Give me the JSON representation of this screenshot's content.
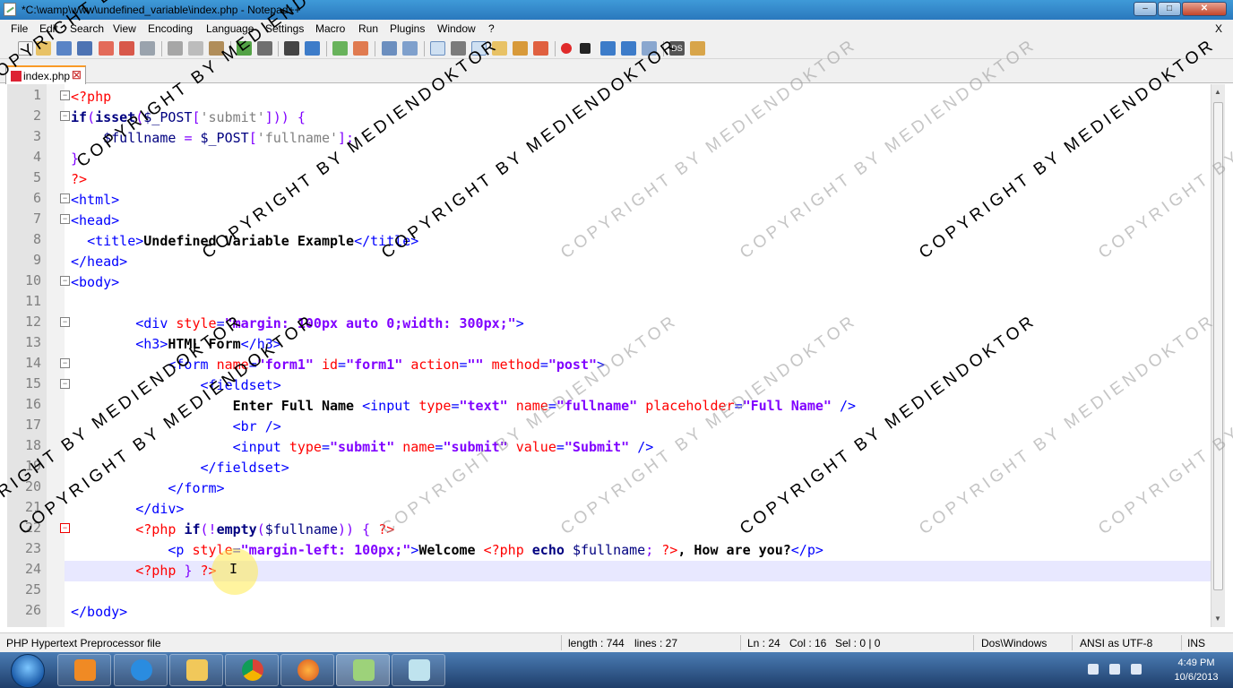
{
  "window": {
    "title": "*C:\\wamp\\www\\undefined_variable\\index.php - Notepad++",
    "minimize": "‒",
    "maximize": "□",
    "close": "✕"
  },
  "menu": [
    "File",
    "Edit",
    "Search",
    "View",
    "Encoding",
    "Language",
    "Settings",
    "Macro",
    "Run",
    "Plugins",
    "Window",
    "?"
  ],
  "menu_close": "X",
  "toolbar_icons": [
    "new-file-icon",
    "open-file-icon",
    "save-icon",
    "save-all-icon",
    "close-icon",
    "close-all-icon",
    "print-icon",
    "cut-icon",
    "copy-icon",
    "paste-icon",
    "undo-icon",
    "redo-icon",
    "find-icon",
    "replace-icon",
    "zoom-in-icon",
    "zoom-out-icon",
    "sync-v-icon",
    "sync-h-icon",
    "word-wrap-icon",
    "show-all-chars-icon",
    "indent-guide-icon",
    "doc-map-icon",
    "function-list-icon",
    "folder-as-workspace-icon",
    "record-macro-icon",
    "stop-record-icon",
    "play-macro-icon",
    "run-macro-multiple-icon",
    "save-macro-icon",
    "ds-icon",
    "spell-check-icon"
  ],
  "tab": {
    "label": "index.php",
    "close": "☒"
  },
  "editor": {
    "line_numbers": [
      "1",
      "2",
      "3",
      "4",
      "5",
      "6",
      "7",
      "8",
      "9",
      "10",
      "11",
      "12",
      "13",
      "14",
      "15",
      "16",
      "17",
      "18",
      "19",
      "20",
      "21",
      "22",
      "23",
      "24",
      "25",
      "26"
    ],
    "current_line": 24
  },
  "status": {
    "file_type": "PHP Hypertext Preprocessor file",
    "length": "length : 744",
    "lines": "lines : 27",
    "ln": "Ln : 24",
    "col": "Col : 16",
    "sel": "Sel : 0 | 0",
    "eol": "Dos\\Windows",
    "encoding": "ANSI as UTF-8",
    "mode": "INS"
  },
  "taskbar": {
    "apps": [
      "media-player-icon",
      "internet-explorer-icon",
      "file-explorer-icon",
      "chrome-icon",
      "firefox-icon",
      "notepadpp-icon",
      "note-app-icon"
    ],
    "time": "4:49 PM",
    "date": "10/6/2013"
  },
  "watermark": {
    "text_dark": "COPYRIGHT BY MEDIENDOKTOR",
    "text_light": "COPYRIGHT BY MEDIENDOKTOR"
  },
  "colors": {
    "keyword": "#000080",
    "php_tag": "#ff0000",
    "html_tag": "#0000ff",
    "attribute": "#ff0000",
    "attr_value": "#8000ff",
    "fold_marker_active": "#ff0000"
  }
}
